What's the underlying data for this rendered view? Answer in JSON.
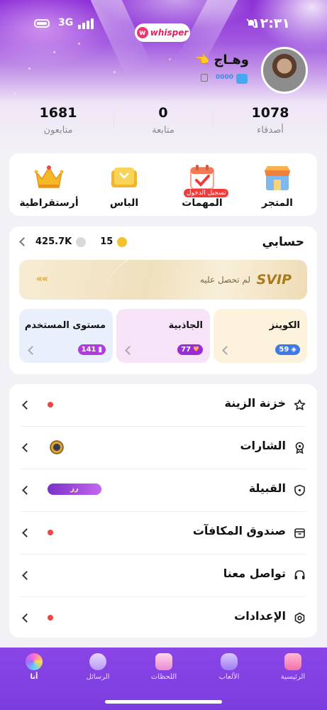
{
  "status_bar": {
    "network": "3G",
    "time": "١٢:٣١",
    "app_logo": "whisper"
  },
  "profile": {
    "username": "وهـاج",
    "id_text": "0000",
    "avatar_icon": "user-avatar-photo"
  },
  "stats": [
    {
      "value": "1078",
      "label": "أصدقاء"
    },
    {
      "value": "0",
      "label": "متابعة"
    },
    {
      "value": "1681",
      "label": "متابعون"
    }
  ],
  "quick_actions": [
    {
      "label": "المتجر",
      "icon": "store-icon"
    },
    {
      "label": "المهمات",
      "icon": "calendar-check-icon",
      "badge": "تسجيل الدخول"
    },
    {
      "label": "الباس",
      "icon": "ticket-pass-icon"
    },
    {
      "label": "أرستقراطية",
      "icon": "crown-icon"
    }
  ],
  "account": {
    "title": "حسابي",
    "diamonds": "425.7K",
    "coins": "15",
    "svip_tag": "SVIP",
    "svip_desc": "لم تحصل عليه",
    "cards": [
      {
        "title": "الكوينز",
        "value": "59",
        "color": "#3f79e6",
        "bg": "#fdf3dc"
      },
      {
        "title": "الجاذبية",
        "value": "77",
        "color": "#9a2cd6",
        "bg": "#f6e3f7"
      },
      {
        "title": "مستوى المستخدم",
        "value": "141",
        "color": "#b23be0",
        "bg": "#e9f0fb"
      }
    ]
  },
  "menu": [
    {
      "label": "خزنة الزينة",
      "icon": "star-icon",
      "dot": true
    },
    {
      "label": "الشارات",
      "icon": "medal-icon",
      "dot": false,
      "badge_icon": "badge-emblem"
    },
    {
      "label": "القبيلة",
      "icon": "shield-icon",
      "dot": false,
      "tribe_tag": "رز"
    },
    {
      "label": "صندوق المكافآت",
      "icon": "gift-box-icon",
      "dot": true
    },
    {
      "label": "تواصل معنا",
      "icon": "headset-icon",
      "dot": false
    },
    {
      "label": "الإعدادات",
      "icon": "settings-icon",
      "dot": true
    }
  ],
  "tabs": [
    {
      "label": "الرئيسية",
      "icon": "home-cake-icon"
    },
    {
      "label": "الألعاب",
      "icon": "gamepad-icon"
    },
    {
      "label": "اللحظات",
      "icon": "moments-icon"
    },
    {
      "label": "الرسائل",
      "icon": "message-bubble-icon"
    },
    {
      "label": "أنا",
      "icon": "me-avatar-icon"
    }
  ]
}
